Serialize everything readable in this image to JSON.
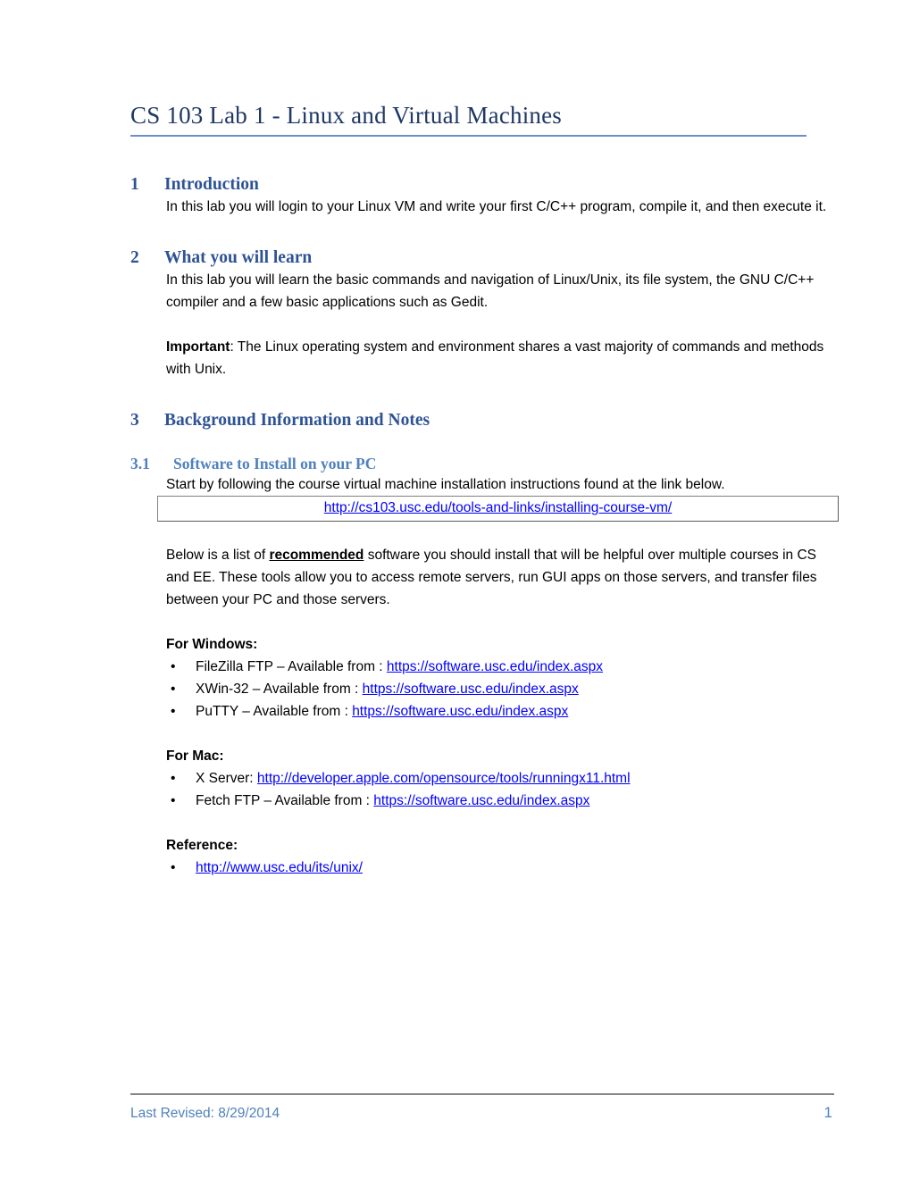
{
  "document": {
    "title": "CS 103 Lab 1 - Linux and Virtual Machines",
    "colors": {
      "title_blue": "#1F3864",
      "heading_blue": "#2E5395",
      "subheading_blue": "#4F81BD",
      "link_blue": "#0000FF",
      "rule_blue": "#6B8FC9",
      "footer_gray": "#868686"
    }
  },
  "sections": {
    "s1": {
      "number": "1",
      "heading": "Introduction",
      "para1": "In this lab you will login to your Linux VM and write your first C/C++ program, compile it, and then execute it."
    },
    "s2": {
      "number": "2",
      "heading": "What you will learn",
      "para1": "In this lab you will learn the basic commands and navigation of Linux/Unix, its file system, the GNU C/C++ compiler and a few basic applications such as Gedit.",
      "important_label": "Important",
      "important_rest": ":  The Linux operating system and environment shares a vast majority of commands and methods with Unix."
    },
    "s3": {
      "number": "3",
      "heading": "Background Information and Notes",
      "sub1": {
        "number": "3.1",
        "heading": "Software to Install on your PC",
        "para1": "Start by following the course virtual machine installation instructions found at the link below.",
        "vm_link": "http://cs103.usc.edu/tools-and-links/installing-course-vm/",
        "para2_pre": "Below is a list of ",
        "para2_emph": "recommended",
        "para2_post": " software you should install that will be helpful over multiple courses in CS and EE.  These tools allow you to access remote servers, run GUI apps on those servers, and transfer files between your PC and those servers.",
        "windows": {
          "label": "For Windows:",
          "items": [
            {
              "text": "FileZilla FTP – Available from :  ",
              "link": "https://software.usc.edu/index.aspx"
            },
            {
              "text": "XWin-32 – Available from :  ",
              "link": "https://software.usc.edu/index.aspx"
            },
            {
              "text": "PuTTY – Available from :  ",
              "link": "https://software.usc.edu/index.aspx"
            }
          ]
        },
        "mac": {
          "label": "For Mac:",
          "items": [
            {
              "text": "X Server: ",
              "link": "http://developer.apple.com/opensource/tools/runningx11.html"
            },
            {
              "text": "Fetch FTP – Available from :  ",
              "link": "https://software.usc.edu/index.aspx"
            }
          ]
        },
        "reference": {
          "label": "Reference:",
          "items": [
            {
              "text": "",
              "link": "http://www.usc.edu/its/unix/"
            }
          ]
        }
      }
    }
  },
  "footer": {
    "revised": "Last Revised: 8/29/2014",
    "page_number": "1"
  }
}
